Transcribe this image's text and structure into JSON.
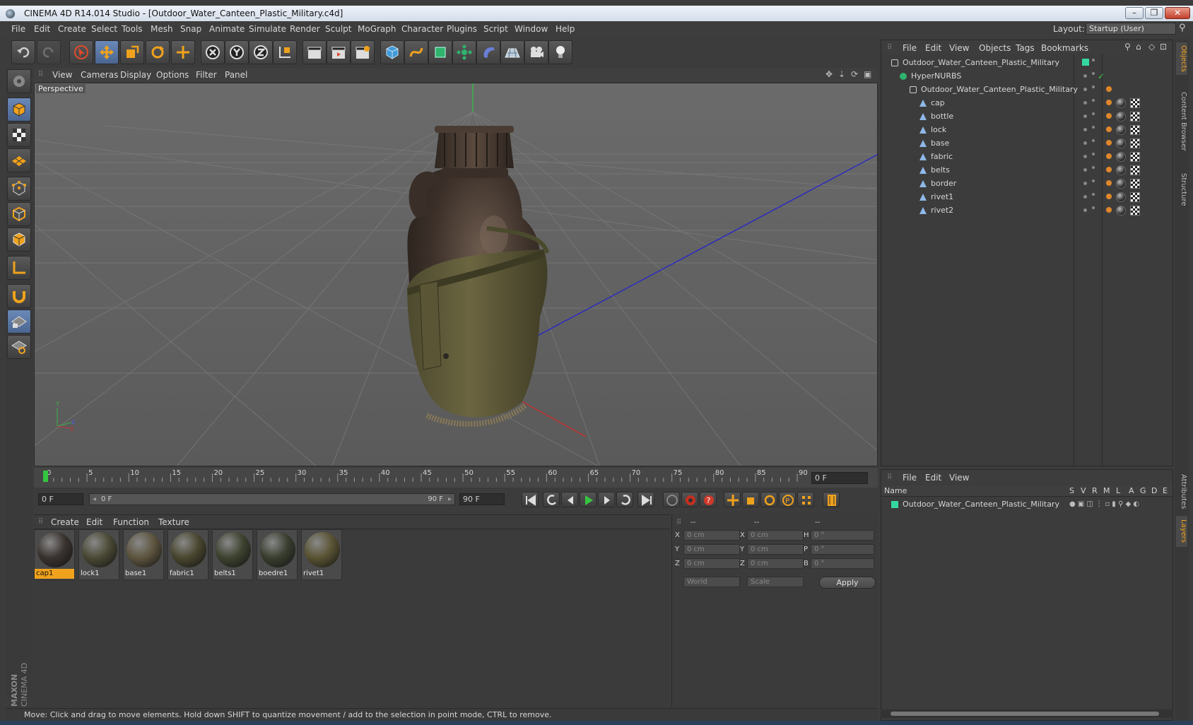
{
  "window": {
    "title": "CINEMA 4D R14.014 Studio - [Outdoor_Water_Canteen_Plastic_Military.c4d]",
    "minimize_label": "–",
    "maximize_label": "❐",
    "close_label": "✕"
  },
  "menubar": {
    "items": [
      "File",
      "Edit",
      "Create",
      "Select",
      "Tools",
      "Mesh",
      "Snap",
      "Animate",
      "Simulate",
      "Render",
      "Sculpt",
      "MoGraph",
      "Character",
      "Plugins",
      "Script",
      "Window",
      "Help"
    ],
    "layout_label": "Layout:",
    "layout_value": "Startup (User)"
  },
  "viewport": {
    "menu": [
      "View",
      "Cameras",
      "Display",
      "Options",
      "Filter",
      "Panel"
    ],
    "label": "Perspective"
  },
  "timeline": {
    "ticks": [
      "0",
      "5",
      "10",
      "15",
      "20",
      "25",
      "30",
      "35",
      "40",
      "45",
      "50",
      "55",
      "60",
      "65",
      "70",
      "75",
      "80",
      "85",
      "90"
    ],
    "current_frame": "0 F",
    "start_frame": "0 F",
    "range_start": "0 F",
    "range_end": "90 F",
    "end_frame": "90 F"
  },
  "materials": {
    "menu": [
      "Create",
      "Edit",
      "Function",
      "Texture"
    ],
    "items": [
      {
        "name": "cap1",
        "color": "#3a3330"
      },
      {
        "name": "lock1",
        "color": "#4b4a36"
      },
      {
        "name": "base1",
        "color": "#5e553f"
      },
      {
        "name": "fabric1",
        "color": "#4a472f"
      },
      {
        "name": "belts1",
        "color": "#3e4330"
      },
      {
        "name": "boedre1",
        "color": "#3a3f30"
      },
      {
        "name": "rivet1",
        "color": "#5a5434"
      }
    ]
  },
  "coords": {
    "headers": [
      "--",
      "--",
      "--"
    ],
    "rows": [
      {
        "a": "X",
        "av": "0 cm",
        "b": "X",
        "bv": "0 cm",
        "c": "H",
        "cv": "0 °"
      },
      {
        "a": "Y",
        "av": "0 cm",
        "b": "Y",
        "bv": "0 cm",
        "c": "P",
        "cv": "0 °"
      },
      {
        "a": "Z",
        "av": "0 cm",
        "b": "Z",
        "bv": "0 cm",
        "c": "B",
        "cv": "0 °"
      }
    ],
    "world": "World",
    "scale": "Scale",
    "apply": "Apply"
  },
  "objects": {
    "menu": [
      "File",
      "Edit",
      "View",
      "Objects",
      "Tags",
      "Bookmarks"
    ],
    "rows": [
      {
        "name": "Outdoor_Water_Canteen_Plastic_Military",
        "type": "null"
      },
      {
        "name": "HyperNURBS",
        "type": "nurbs"
      },
      {
        "name": "Outdoor_Water_Canteen_Plastic_Military",
        "type": "null"
      },
      {
        "name": "cap",
        "type": "poly"
      },
      {
        "name": "bottle",
        "type": "poly"
      },
      {
        "name": "lock",
        "type": "poly"
      },
      {
        "name": "base",
        "type": "poly"
      },
      {
        "name": "fabric",
        "type": "poly"
      },
      {
        "name": "belts",
        "type": "poly"
      },
      {
        "name": "border",
        "type": "poly"
      },
      {
        "name": "rivet1",
        "type": "poly"
      },
      {
        "name": "rivet2",
        "type": "poly"
      }
    ]
  },
  "layers": {
    "menu": [
      "File",
      "Edit",
      "View"
    ],
    "header_name": "Name",
    "header_cols": [
      "S",
      "V",
      "R",
      "M",
      "L",
      "A",
      "G",
      "D",
      "E"
    ],
    "items": [
      {
        "name": "Outdoor_Water_Canteen_Plastic_Military",
        "color": "#35d6a0"
      }
    ]
  },
  "sidetabs": [
    "Objects",
    "Content Browser",
    "Structure",
    "Attributes",
    "Layers"
  ],
  "status": "Move: Click and drag to move elements. Hold down SHIFT to quantize movement / add to the selection in point mode, CTRL to remove.",
  "brand": {
    "maker": "MAXON",
    "product": "CINEMA 4D"
  }
}
